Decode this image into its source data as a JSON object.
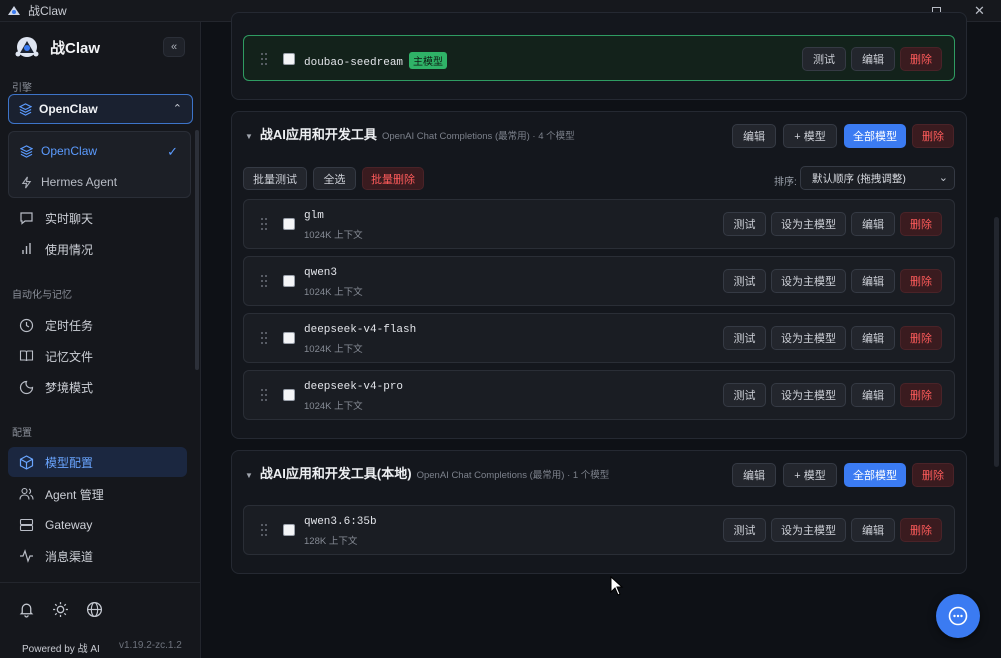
{
  "window": {
    "title": "战Claw",
    "controls": [
      "minimize",
      "maximize",
      "close"
    ]
  },
  "sidebar": {
    "brand": "战Claw",
    "collapse_label": "«",
    "engine_section": "引擎",
    "engine_selected": "OpenClaw",
    "engine_options": [
      {
        "label": "OpenClaw",
        "selected": true,
        "icon": "layers-icon"
      },
      {
        "label": "Hermes Agent",
        "selected": false,
        "icon": "lightning-icon"
      }
    ],
    "nav_top": [
      {
        "label": "实时聊天",
        "icon": "chat-icon"
      },
      {
        "label": "使用情况",
        "icon": "bar-chart-icon"
      }
    ],
    "automation_section": "自动化与记忆",
    "nav_automation": [
      {
        "label": "定时任务",
        "icon": "clock-icon"
      },
      {
        "label": "记忆文件",
        "icon": "book-icon"
      },
      {
        "label": "梦境模式",
        "icon": "moon-icon"
      }
    ],
    "config_section": "配置",
    "nav_config": [
      {
        "label": "模型配置",
        "icon": "cube-icon",
        "active": true
      },
      {
        "label": "Agent 管理",
        "icon": "users-icon"
      },
      {
        "label": "Gateway",
        "icon": "server-icon"
      },
      {
        "label": "消息渠道",
        "icon": "pulse-icon"
      }
    ],
    "powered_by": "Powered by 战 AI",
    "version": "v1.19.2-zc.1.2",
    "bottom_icons": [
      "bell-icon",
      "sun-icon",
      "globe-icon"
    ]
  },
  "main": {
    "top_group": {
      "model": {
        "name": "doubao-seedream",
        "badge": "主模型"
      },
      "buttons": {
        "test": "测试",
        "edit": "编辑",
        "delete": "删除"
      }
    },
    "groups": [
      {
        "title": "战AI应用和开发工具",
        "desc": "OpenAI Chat Completions (最常用) · 4 个模型",
        "header_buttons": {
          "edit": "编辑",
          "add_model": "+ 模型",
          "all_models": "全部模型",
          "delete": "删除"
        },
        "toolbar": {
          "batch_test": "批量测试",
          "select_all": "全选",
          "batch_delete": "批量删除"
        },
        "sort_label": "排序:",
        "sort_value": "默认顺序 (拖拽调整)",
        "models": [
          {
            "name": "glm",
            "context": "1024K 上下文"
          },
          {
            "name": "qwen3",
            "context": "1024K 上下文"
          },
          {
            "name": "deepseek-v4-flash",
            "context": "1024K 上下文"
          },
          {
            "name": "deepseek-v4-pro",
            "context": "1024K 上下文"
          }
        ],
        "row_buttons": {
          "test": "测试",
          "set_primary": "设为主模型",
          "edit": "编辑",
          "delete": "删除"
        }
      },
      {
        "title": "战AI应用和开发工具(本地)",
        "desc": "OpenAI Chat Completions (最常用) · 1 个模型",
        "header_buttons": {
          "edit": "编辑",
          "add_model": "+ 模型",
          "all_models": "全部模型",
          "delete": "删除"
        },
        "models": [
          {
            "name": "qwen3.6:35b",
            "context": "128K 上下文"
          }
        ],
        "row_buttons": {
          "test": "测试",
          "set_primary": "设为主模型",
          "edit": "编辑",
          "delete": "删除"
        }
      }
    ]
  },
  "colors": {
    "accent": "#3b7bf2",
    "primary_badge": "#2fb267",
    "danger": "#ff5b5b",
    "primary_border": "#2f9c62"
  }
}
